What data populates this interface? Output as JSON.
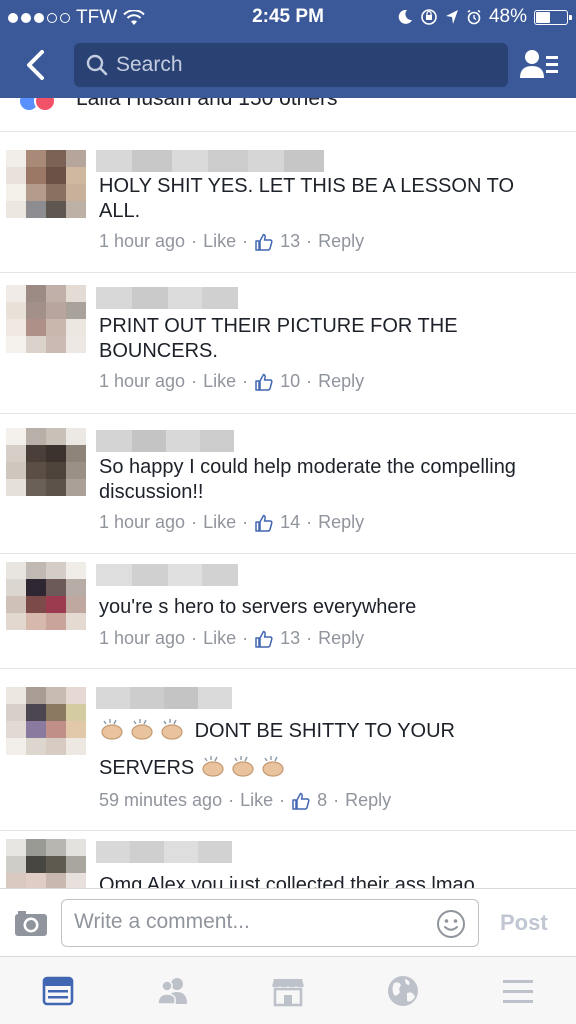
{
  "status_bar": {
    "carrier": "TFW",
    "time": "2:45 PM",
    "battery": "48%",
    "battery_level": 0.48
  },
  "nav": {
    "search_placeholder": "Search"
  },
  "likes_summary": "Laila Husain and 150 others",
  "comments": [
    {
      "text": "HOLY SHIT YES. LET THIS BE A LESSON TO ALL.",
      "time": "1 hour ago",
      "like_label": "Like",
      "like_count": "13",
      "reply_label": "Reply"
    },
    {
      "text": "PRINT OUT THEIR PICTURE FOR THE BOUNCERS.",
      "time": "1 hour ago",
      "like_label": "Like",
      "like_count": "10",
      "reply_label": "Reply"
    },
    {
      "text": "So happy I could help moderate the compelling discussion!!",
      "time": "1 hour ago",
      "like_label": "Like",
      "like_count": "14",
      "reply_label": "Reply"
    },
    {
      "text": "you're s hero to servers everywhere",
      "time": "1 hour ago",
      "like_label": "Like",
      "like_count": "13",
      "reply_label": "Reply"
    },
    {
      "text_part1": "DONT BE SHITTY TO YOUR",
      "text_part2": "SERVERS",
      "time": "59 minutes ago",
      "like_label": "Like",
      "like_count": "8",
      "reply_label": "Reply"
    },
    {
      "text": "Omg Alex you just collected their ass lmao"
    }
  ],
  "composer": {
    "placeholder": "Write a comment...",
    "post_label": "Post"
  },
  "colors": {
    "brand": "#3b5998",
    "meta_gray": "#90949c",
    "tab_active": "#4267b2"
  },
  "icons": [
    "back-chevron-icon",
    "search-icon",
    "friend-requests-icon",
    "camera-icon",
    "emoji-icon",
    "news-feed-icon",
    "friends-icon",
    "marketplace-icon",
    "notifications-globe-icon",
    "menu-icon",
    "thumbs-up-icon",
    "clapping-hands-icon"
  ]
}
